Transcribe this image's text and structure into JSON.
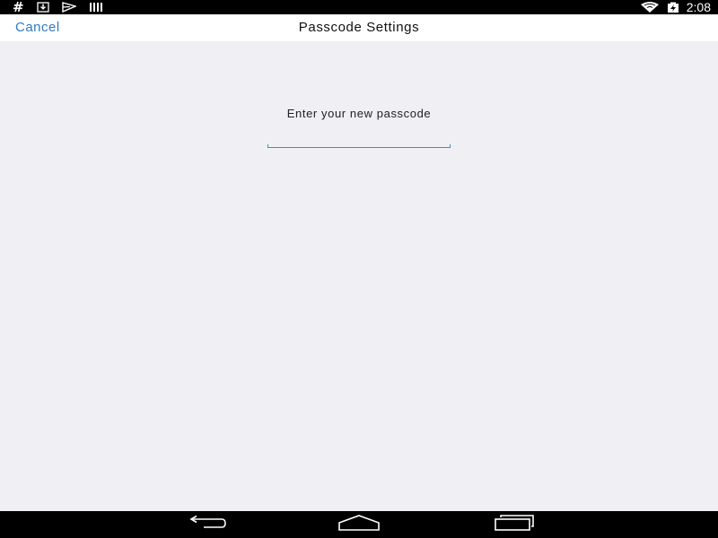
{
  "status_bar": {
    "icons_left": [
      "hash-icon",
      "download-icon",
      "notification-icon",
      "sim-icon"
    ],
    "icons_right": [
      "wifi-icon",
      "battery-charging-icon"
    ],
    "time": "2:08"
  },
  "nav_bar": {
    "cancel_label": "Cancel",
    "title": "Passcode Settings"
  },
  "main": {
    "prompt": "Enter your new passcode",
    "passcode_value": ""
  },
  "system_nav": {
    "buttons": [
      "back-icon",
      "home-icon",
      "recent-apps-icon"
    ]
  },
  "colors": {
    "accent": "#2F7BC2",
    "input_underline": "#2A9BB8",
    "background": "#EFEFF4"
  }
}
